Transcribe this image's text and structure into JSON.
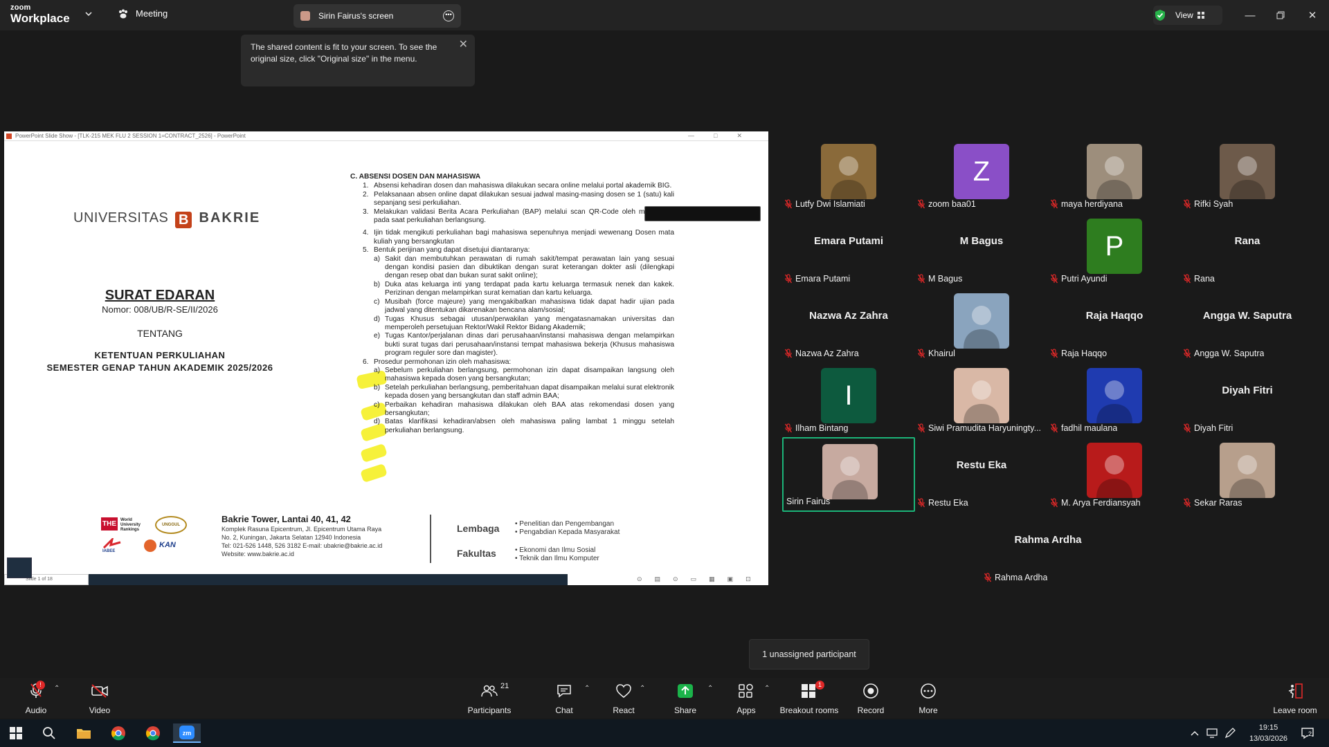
{
  "app": {
    "logo_line1": "zoom",
    "logo_line2": "Workplace",
    "meeting_label": "Meeting",
    "share_tab_label": "Sirin Fairus's screen",
    "view_label": "View"
  },
  "tooltip": {
    "text": "The shared content is fit to your screen. To see the original size, click \"Original size\" in the menu."
  },
  "ppt": {
    "window_title": "PowerPoint Slide Show - [TLK-215 MEK FLU 2 SESSION 1=CONTRACT_2526] - PowerPoint",
    "slide_counter": "Slide 1 of 18",
    "uni_name_left": "UNIVERSITAS",
    "uni_name_right": "BAKRIE",
    "uni_logo_letter": "B",
    "title": "SURAT EDARAN",
    "nomor": "Nomor: 008/UB/R-SE/II/2026",
    "tentang": "TENTANG",
    "ketentuan1": "KETENTUAN PERKULIAHAN",
    "ketentuan2": "SEMESTER GENAP TAHUN AKADEMIK 2025/2026",
    "section_head": "C.  ABSENSI DOSEN DAN MAHASISWA",
    "items": [
      {
        "n": "1.",
        "t": "Absensi kehadiran dosen dan mahasiswa dilakukan secara online melalui portal akademik BIG."
      },
      {
        "n": "2.",
        "t": "Pelaksanaan absen online dapat dilakukan sesuai jadwal masing-masing dosen se 1 (satu) kali sepanjang sesi perkuliahan."
      },
      {
        "n": "3.",
        "t": "Melakukan validasi Berita Acara Perkuliahan (BAP) melalui scan QR-Code oleh mahasiswa pada saat perkuliahan berlangsung."
      },
      {
        "n": "4.",
        "t": "Ijin tidak mengikuti perkuliahan bagi mahasiswa sepenuhnya menjadi wewenang Dosen mata kuliah yang bersangkutan"
      },
      {
        "n": "5.",
        "t": "Bentuk perijinan yang dapat disetujui diantaranya:"
      }
    ],
    "subitems5": [
      {
        "n": "a)",
        "t": "Sakit dan membutuhkan perawatan di rumah sakit/tempat perawatan lain yang sesuai dengan kondisi pasien dan dibuktikan dengan surat keterangan dokter asli (dilengkapi dengan resep obat dan bukan surat sakit online);"
      },
      {
        "n": "b)",
        "t": "Duka atas keluarga inti yang terdapat pada kartu keluarga termasuk nenek dan kakek. Perizinan dengan melampirkan surat kematian dan kartu keluarga."
      },
      {
        "n": "c)",
        "t": "Musibah (force majeure) yang mengakibatkan mahasiswa tidak dapat hadir ujian pada jadwal yang ditentukan dikarenakan bencana alam/sosial;"
      },
      {
        "n": "d)",
        "t": "Tugas Khusus sebagai utusan/perwakilan yang mengatasnamakan universitas dan memperoleh persetujuan Rektor/Wakil Rektor Bidang Akademik;"
      },
      {
        "n": "e)",
        "t": "Tugas Kantor/perjalanan dinas dari perusahaan/instansi mahasiswa dengan melampirkan bukti surat tugas dari perusahaan/instansi tempat mahasiswa bekerja (Khusus mahasiswa program reguler sore dan magister)."
      }
    ],
    "item6": {
      "n": "6.",
      "t": "Prosedur permohonan izin oleh mahasiswa:"
    },
    "subitems6": [
      {
        "n": "a)",
        "t": "Sebelum perkuliahan berlangsung, permohonan izin dapat disampaikan langsung oleh mahasiswa kepada dosen yang bersangkutan;"
      },
      {
        "n": "b)",
        "t": "Setelah perkuliahan berlangsung, pemberitahuan dapat disampaikan melalui surat elektronik kepada dosen yang bersangkutan dan staff admin BAA;"
      },
      {
        "n": "c)",
        "t": "Perbaikan kehadiran mahasiswa dilakukan oleh BAA atas rekomendasi dosen yang bersangkutan;"
      },
      {
        "n": "d)",
        "t": "Batas klarifikasi kehadiran/absen oleh mahasiswa paling lambat 1 minggu setelah perkuliahan berlangsung."
      }
    ],
    "footer": {
      "logo_the": "THE",
      "logo_wur": "World University Rankings",
      "logo_unggul": "UNGGUL",
      "logo_iabee": "IABEE",
      "logo_kan": "KAN",
      "addr_title": "Bakrie Tower, Lantai 40, 41, 42",
      "addr1": "Komplek Rasuna Epicentrum, Jl. Epicentrum Utama Raya",
      "addr2": "No. 2, Kuningan, Jakarta Selatan 12940 Indonesia",
      "addr3": "Tel: 021-526 1448, 526 3182  E-mail: ubakrie@bakrie.ac.id",
      "addr4": "Website: www.bakrie.ac.id",
      "lembaga": "Lembaga",
      "lembaga_i1": "• Penelitian dan Pengembangan",
      "lembaga_i2": "• Pengabdian Kepada Masyarakat",
      "fakultas": "Fakultas",
      "fakultas_i1": "• Ekonomi dan Ilmu Sosial",
      "fakultas_i2": "• Teknik dan Ilmu Komputer"
    }
  },
  "participants": [
    {
      "name": "Lutfy Dwi Islamiati",
      "type": "photo",
      "color": "#8a6a3a"
    },
    {
      "name": "zoom baa01",
      "type": "letter",
      "letter": "Z",
      "color": "#8a4fc7"
    },
    {
      "name": "maya herdiyana",
      "type": "photo",
      "color": "#9d8e7c"
    },
    {
      "name": "Rifki Syah",
      "type": "photo",
      "color": "#6d5a4a"
    },
    {
      "name": "Emara Putami",
      "type": "name"
    },
    {
      "name": "M Bagus",
      "type": "name"
    },
    {
      "name": "Putri Ayundi",
      "type": "letter",
      "letter": "P",
      "color": "#2e7d1f"
    },
    {
      "name": "Rana",
      "type": "name"
    },
    {
      "name": "Nazwa Az Zahra",
      "type": "name"
    },
    {
      "name": "Khairul",
      "type": "photo",
      "color": "#8aa4be"
    },
    {
      "name": "Raja Haqqo",
      "type": "name"
    },
    {
      "name": "Angga W. Saputra",
      "type": "name"
    },
    {
      "name": "Ilham Bintang",
      "type": "letter",
      "letter": "I",
      "color": "#0d5a3e"
    },
    {
      "name": "Siwi Pramudita Haryuningty...",
      "type": "photo",
      "color": "#d9b8a6"
    },
    {
      "name": "fadhil maulana",
      "type": "photo",
      "color": "#1f3bb0"
    },
    {
      "name": "Diyah Fitri",
      "type": "name"
    },
    {
      "name": "Sirin Fairus",
      "type": "photo",
      "color": "#c7aaa0",
      "active": true,
      "nomic": true
    },
    {
      "name": "Restu Eka",
      "type": "name"
    },
    {
      "name": "M. Arya Ferdiansyah",
      "type": "photo",
      "color": "#b81b1b"
    },
    {
      "name": "Sekar Raras",
      "type": "photo",
      "color": "#b79f8c"
    },
    {
      "name": "Rahma Ardha",
      "type": "name"
    }
  ],
  "breakout_tooltip": "1 unassigned participant",
  "toolbar": {
    "audio": "Audio",
    "video": "Video",
    "participants": "Participants",
    "participants_count": "21",
    "chat": "Chat",
    "react": "React",
    "share": "Share",
    "apps": "Apps",
    "breakout": "Breakout rooms",
    "breakout_badge": "1",
    "record": "Record",
    "more": "More",
    "leave": "Leave room"
  },
  "taskbar": {
    "time": "19:15",
    "date": "13/03/2026",
    "notif_count": "2"
  },
  "colors": {
    "accent_green": "#1bb579",
    "highlight_yellow": "#f5ef18",
    "mute_red": "#e02828"
  }
}
